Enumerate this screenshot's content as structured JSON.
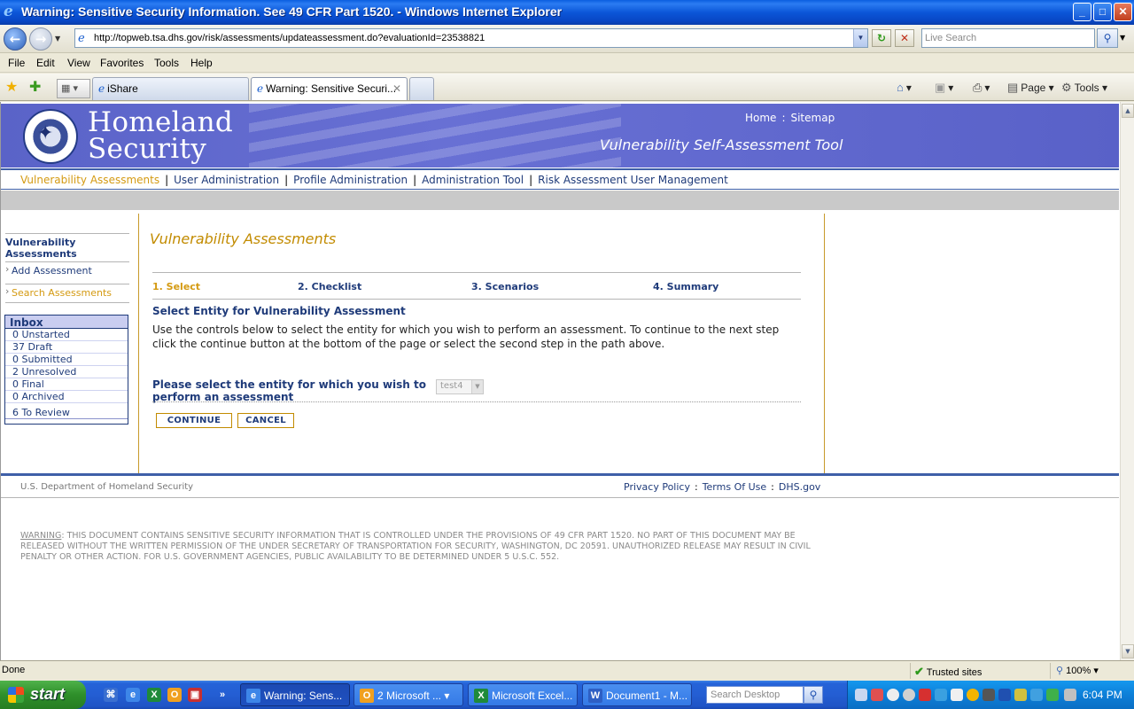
{
  "window": {
    "title": "Warning: Sensitive Security Information. See 49 CFR Part 1520. - Windows Internet Explorer",
    "min": "_",
    "max": "□",
    "close": "✕"
  },
  "address": {
    "url": "http://topweb.tsa.dhs.gov/risk/assessments/updateassessment.do?evaluationId=23538821",
    "search_placeholder": "Live Search"
  },
  "menu": [
    "File",
    "Edit",
    "View",
    "Favorites",
    "Tools",
    "Help"
  ],
  "tabs": [
    {
      "label": "iShare"
    },
    {
      "label": "Warning: Sensitive Securi..."
    }
  ],
  "commands": {
    "page": "Page",
    "tools": "Tools"
  },
  "site": {
    "logo_line1": "Homeland",
    "logo_line2": "Security",
    "home": "Home",
    "sitemap": "Sitemap",
    "tool_title": "Vulnerability Self-Assessment Tool",
    "nav": [
      "Vulnerability Assessments",
      "User Administration",
      "Profile Administration",
      "Administration Tool",
      "Risk Assessment User Management"
    ]
  },
  "sidebar": {
    "header": "Vulnerability Assessments",
    "add": "Add Assessment",
    "search": "Search Assessments",
    "inbox_title": "Inbox",
    "inbox": [
      "0 Unstarted",
      "37 Draft",
      "0 Submitted",
      "2 Unresolved",
      "0 Final",
      "0 Archived"
    ],
    "review": "6 To Review"
  },
  "main": {
    "title": "Vulnerability Assessments",
    "steps": [
      "1. Select",
      "2. Checklist",
      "3. Scenarios",
      "4. Summary"
    ],
    "section_title": "Select Entity for Vulnerability Assessment",
    "instructions": "Use the controls below to select the entity for which you wish to perform an assessment. To continue to the next step click the continue button at the bottom of the page or select the second step in the path above.",
    "prompt": "Please select the entity for which you wish to perform an assessment",
    "entity_value": "test4",
    "continue": "CONTINUE",
    "cancel": "CANCEL"
  },
  "footer": {
    "dept": "U.S. Department of Homeland Security",
    "privacy": "Privacy Policy",
    "terms": "Terms Of Use",
    "dhs": "DHS.gov",
    "warning_label": "WARNING",
    "warning_text": ": THIS DOCUMENT CONTAINS SENSITIVE SECURITY INFORMATION THAT IS CONTROLLED UNDER THE PROVISIONS OF 49 CFR PART 1520. NO PART OF THIS DOCUMENT MAY BE RELEASED WITHOUT THE WRITTEN PERMISSION OF THE UNDER SECRETARY OF TRANSPORTATION FOR SECURITY, WASHINGTON, DC 20591. UNAUTHORIZED RELEASE MAY RESULT IN CIVIL PENALTY OR OTHER ACTION. FOR U.S. GOVERNMENT AGENCIES, PUBLIC AVAILABILITY TO BE DETERMINED UNDER 5 U.S.C. 552."
  },
  "status": {
    "text": "Done",
    "zone": "Trusted sites",
    "zoom": "100%"
  },
  "taskbar": {
    "start": "start",
    "tasks": [
      "Warning: Sens...",
      "2 Microsoft ...",
      "Microsoft Excel...",
      "Document1 - M..."
    ],
    "search_placeholder": "Search Desktop",
    "clock": "6:04 PM"
  },
  "colors": {
    "banner": "#5a63c8",
    "nav_text": "#1f3b7a",
    "accent_gold": "#d49a12",
    "rule_blue": "#3e5fa8"
  }
}
